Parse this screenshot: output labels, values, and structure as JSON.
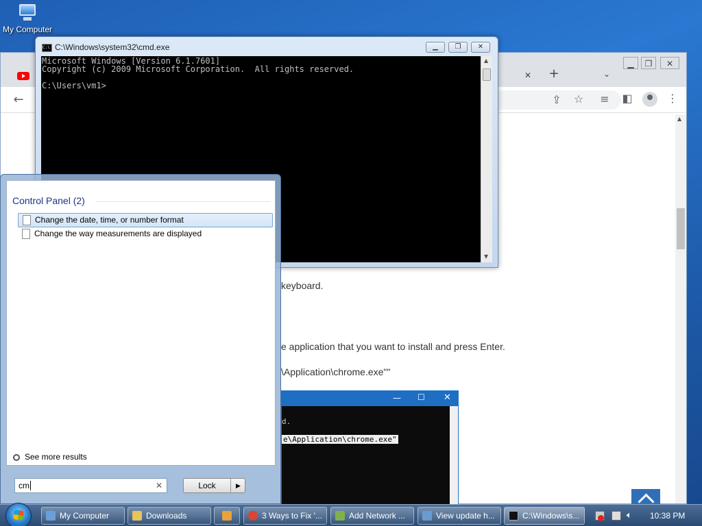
{
  "desktop": {
    "icon_label": "My Computer"
  },
  "chrome": {
    "tab_close": "✕",
    "tab_new": "+",
    "tab_menu": "⌄",
    "page_lines": [
      "keyboard.",
      "e application that you want to install and press Enter.",
      "\\Application\\chrome.exe\"\""
    ],
    "embed_lines": [
      "d.",
      "e\\Application\\chrome.exe\""
    ]
  },
  "cmd": {
    "title": "C:\\Windows\\system32\\cmd.exe",
    "lines": [
      "Microsoft Windows [Version 6.1.7601]",
      "Copyright (c) 2009 Microsoft Corporation.  All rights reserved.",
      "",
      "C:\\Users\\vm1>"
    ]
  },
  "start_menu": {
    "group_heading": "Control Panel (2)",
    "results": [
      "Change the date, time, or number format",
      "Change the way measurements are displayed"
    ],
    "see_more": "See more results",
    "search_value": "cm",
    "lock_label": "Lock"
  },
  "taskbar": {
    "items": [
      {
        "label": "My Computer",
        "color": "#6aa0d8"
      },
      {
        "label": "Downloads",
        "color": "#e8c45a"
      },
      {
        "label": "",
        "color": "#e9a23b"
      },
      {
        "label": "3 Ways to Fix '...",
        "color": "#db4437"
      },
      {
        "label": "Add Network ...",
        "color": "#7fb04c"
      },
      {
        "label": "View update h...",
        "color": "#6a9bd0"
      },
      {
        "label": "C:\\Windows\\s...",
        "color": "#111111"
      }
    ],
    "clock": "10:38 PM"
  }
}
